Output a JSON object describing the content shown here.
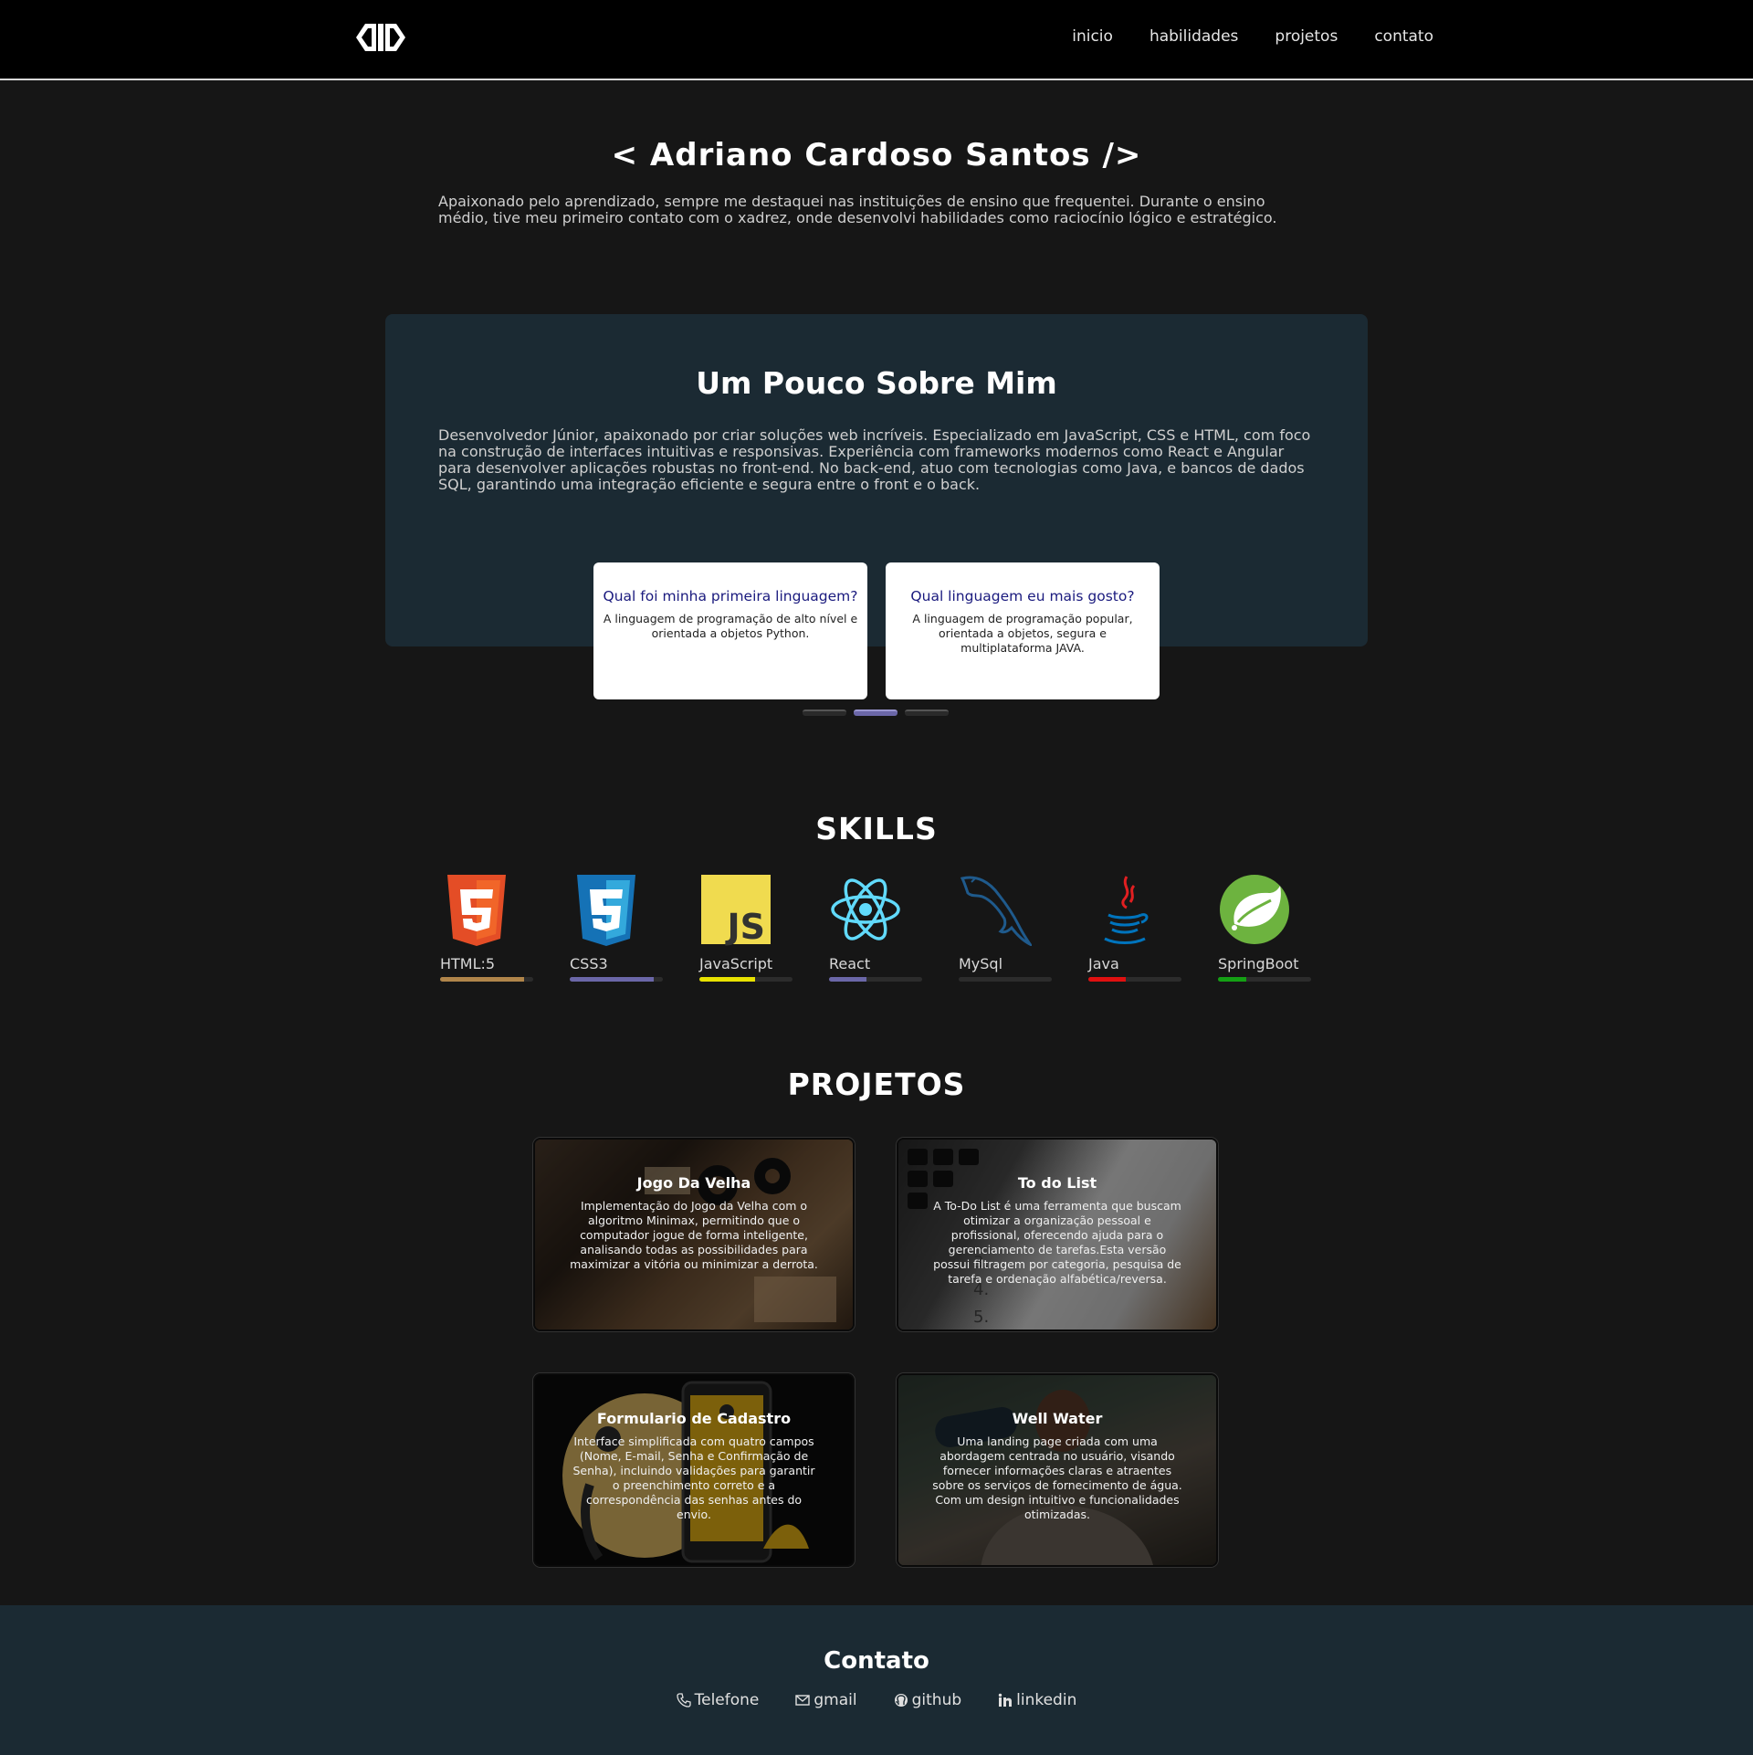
{
  "nav": {
    "logo": "logo-icon",
    "links": [
      "inicio",
      "habilidades",
      "projetos",
      "contato"
    ]
  },
  "hero": {
    "title": "< Adriano Cardoso Santos />",
    "text": "Apaixonado pelo aprendizado, sempre me destaquei nas instituições de ensino que frequentei. Durante o ensino médio, tive meu primeiro contato com o xadrez, onde desenvolvi habilidades como raciocínio lógico e estratégico."
  },
  "about": {
    "title": "Um Pouco Sobre Mim",
    "text": "Desenvolvedor Júnior, apaixonado por criar soluções web incríveis. Especializado em JavaScript, CSS e HTML, com foco na construção de interfaces intuitivas e responsivas. Experiência com frameworks modernos como React e Angular para desenvolver aplicações robustas no front-end. No back-end, atuo com tecnologias como Java, e bancos de dados SQL, garantindo uma integração eficiente e segura entre o front e o back.",
    "cards": [
      {
        "title": "Qual foi minha primeira linguagem?",
        "text": "A linguagem de programação de alto nível e orientada a objetos Python."
      },
      {
        "title": "Qual linguagem eu mais gosto?",
        "text": "A linguagem de programação popular, orientada a objetos, segura e multiplataforma JAVA."
      }
    ],
    "carousel_active": 1
  },
  "skills": {
    "title": "SKILLS",
    "items": [
      {
        "label": "HTML:5",
        "icon": "html5-icon",
        "level": 0.9,
        "color": "#b0854a"
      },
      {
        "label": "CSS3",
        "icon": "css3-icon",
        "level": 0.9,
        "color": "#6b67a8"
      },
      {
        "label": "JavaScript",
        "icon": "javascript-icon",
        "level": 0.6,
        "color": "#e8e200"
      },
      {
        "label": "React",
        "icon": "react-icon",
        "level": 0.4,
        "color": "#6b67a8"
      },
      {
        "label": "MySql",
        "icon": "mysql-icon",
        "level": 0.0,
        "color": "#6b67a8"
      },
      {
        "label": "Java",
        "icon": "java-icon",
        "level": 0.4,
        "color": "#e01010"
      },
      {
        "label": "SpringBoot",
        "icon": "springboot-icon",
        "level": 0.3,
        "color": "#14a014"
      }
    ]
  },
  "projects": {
    "title": "PROJETOS",
    "items": [
      {
        "title": "Jogo Da Velha",
        "text": "Implementação do Jogo da Velha com o algoritmo Minimax, permitindo que o computador jogue de forma inteligente, analisando todas as possibilidades para maximizar a vitória ou minimizar a derrota."
      },
      {
        "title": "To do List",
        "text": "A To-Do List é uma ferramenta que buscam otimizar a organização pessoal e profissional, oferecendo ajuda para o gerenciamento de tarefas.Esta versão possui filtragem por categoria, pesquisa de tarefa e ordenação alfabética/reversa."
      },
      {
        "title": "Formulario de Cadastro",
        "text": "Interface simplificada com quatro campos (Nome, E-mail, Senha e Confirmação de Senha), incluindo validações para garantir o preenchimento correto e a correspondência das senhas antes do envio."
      },
      {
        "title": "Well Water",
        "text": "Uma landing page criada com uma abordagem centrada no usuário, visando fornecer informações claras e atraentes sobre os serviços de fornecimento de água. Com um design intuitivo e funcionalidades otimizadas."
      }
    ]
  },
  "footer": {
    "title": "Contato",
    "contacts": [
      {
        "label": "Telefone",
        "icon": "phone-icon"
      },
      {
        "label": "gmail",
        "icon": "mail-icon"
      },
      {
        "label": "github",
        "icon": "github-icon"
      },
      {
        "label": "linkedin",
        "icon": "linkedin-icon"
      }
    ]
  }
}
